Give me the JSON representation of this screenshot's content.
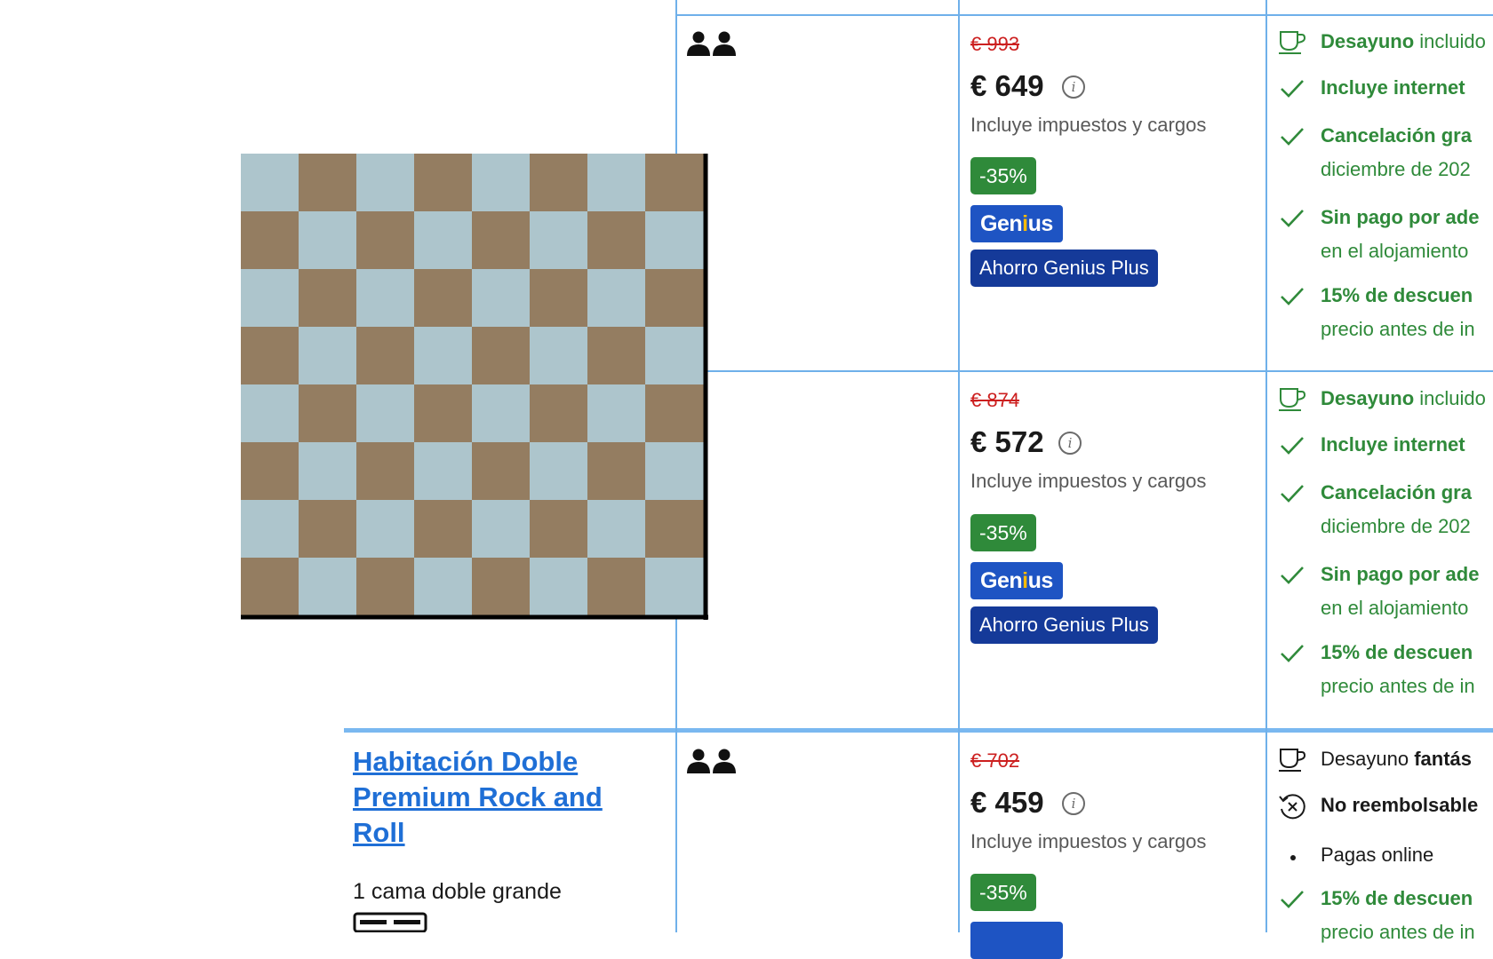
{
  "colors": {
    "grid_line": "#6fb0ea",
    "price_strike": "#cc1f1f",
    "discount_bg": "#2f8a3a",
    "genius_bg": "#1e54c3",
    "genius_plus_bg": "#153a99",
    "feature_green": "#2f8a3a",
    "link_blue": "#1f6fd6",
    "board_light": "#adc5cc",
    "board_dark": "#947d61"
  },
  "icons": {
    "occupancy": "two-person-icon",
    "info": "info-icon",
    "breakfast": "coffee-cup-icon",
    "check": "check-icon",
    "no_refund": "no-refund-icon",
    "bed": "bed-icon",
    "bullet": "bullet-icon"
  },
  "rows": [
    {
      "original_price": "€ 993",
      "price": "€ 649",
      "taxes": "Incluye impuestos y cargos",
      "discount": "-35%",
      "genius_label": "Genius",
      "genius_plus_label": "Ahorro Genius Plus",
      "features": [
        {
          "bold": "Desayuno",
          "rest": " incluido"
        },
        {
          "bold": "Incluye internet",
          "rest": ""
        },
        {
          "bold": "Cancelación gra",
          "rest": "",
          "line2": "diciembre de 202"
        },
        {
          "bold": "Sin pago por ade",
          "rest": "",
          "line2": "en el alojamiento"
        },
        {
          "bold": "15% de descuen",
          "rest": "",
          "line2": "precio antes de in"
        }
      ]
    },
    {
      "original_price": "€ 874",
      "price": "€ 572",
      "taxes": "Incluye impuestos y cargos",
      "discount": "-35%",
      "genius_label": "Genius",
      "genius_plus_label": "Ahorro Genius Plus",
      "features": [
        {
          "bold": "Desayuno",
          "rest": " incluido"
        },
        {
          "bold": "Incluye internet",
          "rest": ""
        },
        {
          "bold": "Cancelación gra",
          "rest": "",
          "line2": "diciembre de 202"
        },
        {
          "bold": "Sin pago por ade",
          "rest": "",
          "line2": "en el alojamiento"
        },
        {
          "bold": "15% de descuen",
          "rest": "",
          "line2": "precio antes de in"
        }
      ]
    },
    {
      "room_name": "Habitación Doble Premium Rock and Roll",
      "bed": "1 cama doble grande",
      "original_price": "€ 702",
      "price": "€ 459",
      "taxes": "Incluye impuestos y cargos",
      "discount": "-35%",
      "features": [
        {
          "rest": "Desayuno ",
          "bold": "fantás"
        },
        {
          "bold": "No reembolsable",
          "rest": ""
        },
        {
          "rest": "Pagas online",
          "bold": ""
        },
        {
          "bold": "15% de descuen",
          "rest": "",
          "line2": "precio antes de in"
        }
      ]
    }
  ]
}
